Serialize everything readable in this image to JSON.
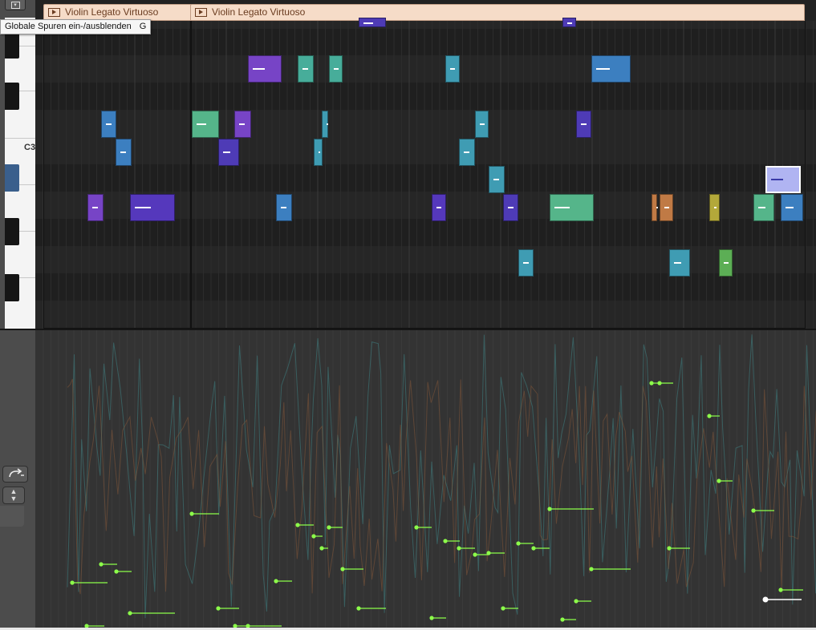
{
  "tooltip": {
    "text": "Globale Spuren ein-/ausblenden",
    "shortcut": "G"
  },
  "piano": {
    "c3_label": "C3"
  },
  "regions": [
    {
      "name": "Violin Legato Virtuoso"
    },
    {
      "name": "Violin Legato Virtuoso"
    }
  ],
  "notes": [
    {
      "row": -1,
      "start": 447,
      "end": 481,
      "color": "#4e3bb6"
    },
    {
      "row": -1,
      "start": 701,
      "end": 718,
      "color": "#4e3bb6"
    },
    {
      "row": 0,
      "start": 309,
      "end": 351,
      "color": "#7744c6"
    },
    {
      "row": 0,
      "start": 371,
      "end": 391,
      "color": "#47ad9a"
    },
    {
      "row": 0,
      "start": 410,
      "end": 427,
      "color": "#47ad9a"
    },
    {
      "row": 0,
      "start": 555,
      "end": 573,
      "color": "#3f9cb3"
    },
    {
      "row": 0,
      "start": 737,
      "end": 786,
      "color": "#3c7fc0"
    },
    {
      "row": 2,
      "start": 126,
      "end": 145,
      "color": "#3c7fc0"
    },
    {
      "row": 2,
      "start": 239,
      "end": 273,
      "color": "#55b58a"
    },
    {
      "row": 2,
      "start": 292,
      "end": 313,
      "color": "#7744c6"
    },
    {
      "row": 2,
      "start": 401,
      "end": 409,
      "color": "#3f9cb3"
    },
    {
      "row": 2,
      "start": 592,
      "end": 609,
      "color": "#3f9cb3"
    },
    {
      "row": 2,
      "start": 718,
      "end": 737,
      "color": "#4e3bb6"
    },
    {
      "row": 3,
      "start": 144,
      "end": 164,
      "color": "#3c7fc0"
    },
    {
      "row": 3,
      "start": 272,
      "end": 298,
      "color": "#4e3bb6"
    },
    {
      "row": 3,
      "start": 391,
      "end": 402,
      "color": "#3f9cb3"
    },
    {
      "row": 3,
      "start": 572,
      "end": 592,
      "color": "#3f9cb3"
    },
    {
      "row": 4,
      "start": 609,
      "end": 629,
      "color": "#3f9cb3"
    },
    {
      "row": 4,
      "start": 954,
      "end": 998,
      "color": "#b0b4f2",
      "selected": true
    },
    {
      "row": 5,
      "start": 109,
      "end": 129,
      "color": "#7744c6"
    },
    {
      "row": 5,
      "start": 162,
      "end": 218,
      "color": "#5538bc"
    },
    {
      "row": 5,
      "start": 344,
      "end": 364,
      "color": "#3c7fc0"
    },
    {
      "row": 5,
      "start": 538,
      "end": 556,
      "color": "#5538bc"
    },
    {
      "row": 5,
      "start": 627,
      "end": 646,
      "color": "#4e3bb6"
    },
    {
      "row": 5,
      "start": 685,
      "end": 740,
      "color": "#55b58a"
    },
    {
      "row": 5,
      "start": 812,
      "end": 819,
      "color": "#c07a45"
    },
    {
      "row": 5,
      "start": 822,
      "end": 839,
      "color": "#c07a45"
    },
    {
      "row": 5,
      "start": 884,
      "end": 897,
      "color": "#b3a83a"
    },
    {
      "row": 5,
      "start": 939,
      "end": 965,
      "color": "#55b58a"
    },
    {
      "row": 5,
      "start": 973,
      "end": 1001,
      "color": "#3c7fc0"
    },
    {
      "row": 7,
      "start": 646,
      "end": 665,
      "color": "#3f9cb3"
    },
    {
      "row": 7,
      "start": 834,
      "end": 860,
      "color": "#3f9cb3"
    },
    {
      "row": 7,
      "start": 896,
      "end": 913,
      "color": "#5cae55"
    }
  ],
  "automation_points": [
    [
      90,
      727,
      134
    ],
    [
      126,
      704,
      146
    ],
    [
      145,
      713,
      164
    ],
    [
      108,
      781,
      130
    ],
    [
      162,
      765,
      218
    ],
    [
      239,
      641,
      273
    ],
    [
      272,
      759,
      298
    ],
    [
      293,
      781,
      309
    ],
    [
      309,
      781,
      351
    ],
    [
      344,
      725,
      364
    ],
    [
      371,
      655,
      391
    ],
    [
      391,
      669,
      402
    ],
    [
      401,
      684,
      409
    ],
    [
      410,
      658,
      427
    ],
    [
      427,
      710,
      453
    ],
    [
      447,
      759,
      481
    ],
    [
      519,
      658,
      538
    ],
    [
      538,
      771,
      556
    ],
    [
      555,
      675,
      573
    ],
    [
      572,
      684,
      592
    ],
    [
      592,
      692,
      609
    ],
    [
      609,
      690,
      629
    ],
    [
      627,
      759,
      646
    ],
    [
      646,
      678,
      665
    ],
    [
      665,
      684,
      685
    ],
    [
      685,
      635,
      740
    ],
    [
      701,
      773,
      718
    ],
    [
      718,
      750,
      737
    ],
    [
      737,
      710,
      786
    ],
    [
      812,
      478,
      822
    ],
    [
      822,
      478,
      839
    ],
    [
      834,
      684,
      860
    ],
    [
      884,
      519,
      897
    ],
    [
      896,
      600,
      913
    ],
    [
      939,
      637,
      965
    ],
    [
      973,
      736,
      1001
    ]
  ],
  "colors": {
    "editor_bg": "#222222",
    "lane_dark": "#1f1f1f",
    "lane_light": "#262626",
    "automation_bg": "#333333",
    "automation_point": "#8cff4a",
    "region_header": "#f6dcc8"
  }
}
